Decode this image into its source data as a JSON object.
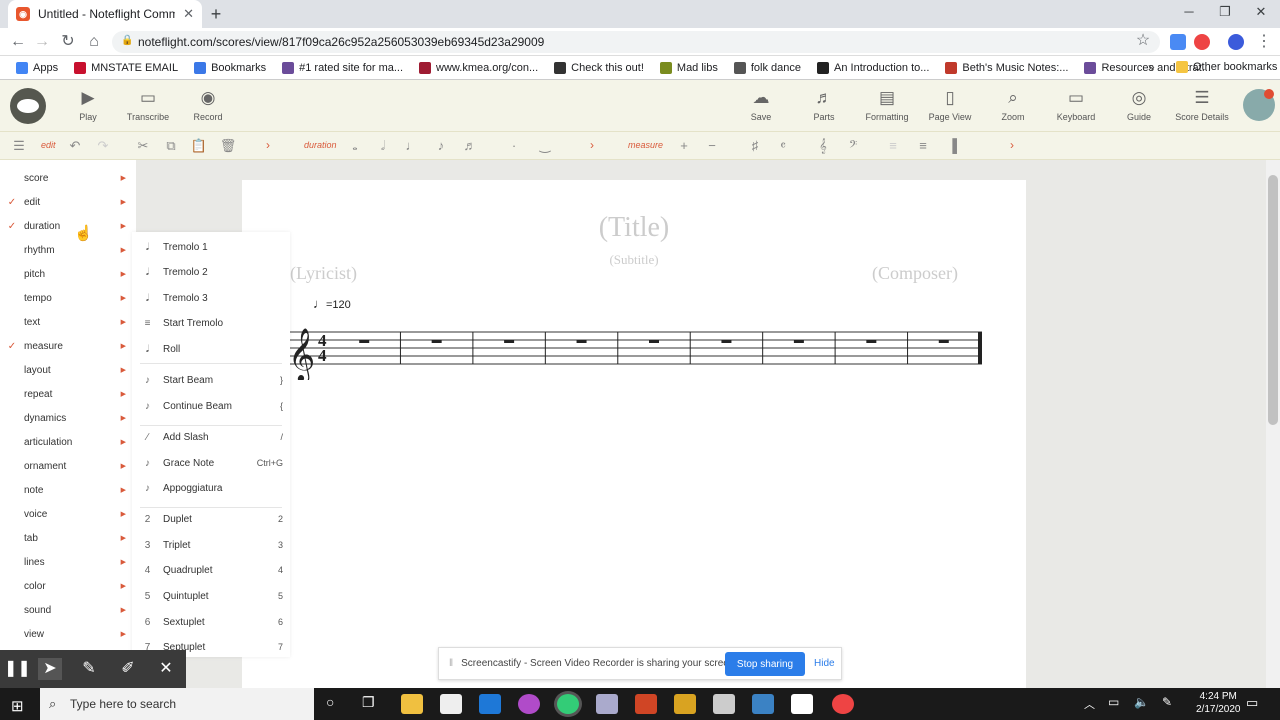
{
  "browser": {
    "tab_title": "Untitled - Noteflight Community",
    "url": "noteflight.com/scores/view/817f09ca26c952a256053039eb69345d23a29009",
    "bookmarks": [
      {
        "label": "Apps",
        "color": "#4285f4"
      },
      {
        "label": "MNSTATE EMAIL",
        "color": "#c8102e"
      },
      {
        "label": "Bookmarks",
        "color": "#3b78e7"
      },
      {
        "label": "#1 rated site for ma...",
        "color": "#6b4c9a"
      },
      {
        "label": "www.kmea.org/con...",
        "color": "#9e1b32"
      },
      {
        "label": "Check this out!",
        "color": "#333333"
      },
      {
        "label": "Mad libs",
        "color": "#7a8c1f"
      },
      {
        "label": "folk dance",
        "color": "#555555"
      },
      {
        "label": "An Introduction to...",
        "color": "#222222"
      },
      {
        "label": "Beth's Music Notes:...",
        "color": "#c0392b"
      },
      {
        "label": "Resources and Strat...",
        "color": "#6b4c9a"
      }
    ],
    "other_bookmarks": "Other bookmarks",
    "overflow": "»"
  },
  "toolbar": {
    "left": [
      {
        "label": "Play",
        "icon": "play-icon"
      },
      {
        "label": "Transcribe",
        "icon": "keyboard-icon"
      },
      {
        "label": "Record",
        "icon": "record-icon"
      }
    ],
    "right": [
      {
        "label": "Save",
        "icon": "cloud-icon"
      },
      {
        "label": "Parts",
        "icon": "guitar-icon"
      },
      {
        "label": "Formatting",
        "icon": "formatting-icon"
      },
      {
        "label": "Page View",
        "icon": "page-icon"
      },
      {
        "label": "Zoom",
        "icon": "zoom-icon"
      },
      {
        "label": "Keyboard",
        "icon": "keyboard-icon"
      },
      {
        "label": "Guide",
        "icon": "guide-icon"
      },
      {
        "label": "Score Details",
        "icon": "details-icon"
      }
    ]
  },
  "subtoolbar": {
    "edit": "edit",
    "duration": "duration",
    "measure": "measure"
  },
  "menu": {
    "items": [
      {
        "label": "score",
        "checked": false
      },
      {
        "label": "edit",
        "checked": true
      },
      {
        "label": "duration",
        "checked": true
      },
      {
        "label": "rhythm",
        "checked": false
      },
      {
        "label": "pitch",
        "checked": false
      },
      {
        "label": "tempo",
        "checked": false
      },
      {
        "label": "text",
        "checked": false
      },
      {
        "label": "measure",
        "checked": true
      },
      {
        "label": "layout",
        "checked": false
      },
      {
        "label": "repeat",
        "checked": false
      },
      {
        "label": "dynamics",
        "checked": false
      },
      {
        "label": "articulation",
        "checked": false
      },
      {
        "label": "ornament",
        "checked": false
      },
      {
        "label": "note",
        "checked": false
      },
      {
        "label": "voice",
        "checked": false
      },
      {
        "label": "tab",
        "checked": false
      },
      {
        "label": "lines",
        "checked": false
      },
      {
        "label": "color",
        "checked": false
      },
      {
        "label": "sound",
        "checked": false
      },
      {
        "label": "view",
        "checked": false
      }
    ],
    "check": "✓"
  },
  "submenu": {
    "items": [
      {
        "label": "Tremolo 1",
        "shortcut": "",
        "icon": "𝅘𝅥"
      },
      {
        "label": "Tremolo 2",
        "shortcut": "",
        "icon": "𝅘𝅥"
      },
      {
        "label": "Tremolo 3",
        "shortcut": "",
        "icon": "𝅘𝅥"
      },
      {
        "label": "Start Tremolo",
        "shortcut": "",
        "icon": "≡"
      },
      {
        "label": "Roll",
        "shortcut": "",
        "icon": "𝅘𝅥"
      },
      {
        "label": "Start Beam",
        "shortcut": "}",
        "icon": "♪"
      },
      {
        "label": "Continue Beam",
        "shortcut": "{",
        "icon": "♪"
      },
      {
        "label": "Add Slash",
        "shortcut": "/",
        "icon": "∕"
      },
      {
        "label": "Grace Note",
        "shortcut": "Ctrl+G",
        "icon": "♪"
      },
      {
        "label": "Appoggiatura",
        "shortcut": "",
        "icon": "♪"
      },
      {
        "label": "Duplet",
        "shortcut": "2",
        "icon": "2"
      },
      {
        "label": "Triplet",
        "shortcut": "3",
        "icon": "3"
      },
      {
        "label": "Quadruplet",
        "shortcut": "4",
        "icon": "4"
      },
      {
        "label": "Quintuplet",
        "shortcut": "5",
        "icon": "5"
      },
      {
        "label": "Sextuplet",
        "shortcut": "6",
        "icon": "6"
      },
      {
        "label": "Septuplet",
        "shortcut": "7",
        "icon": "7"
      }
    ]
  },
  "score": {
    "title": "(Title)",
    "subtitle": "(Subtitle)",
    "lyricist": "(Lyricist)",
    "composer": "(Composer)",
    "tempo": "=120",
    "time_top": "4",
    "time_bottom": "4",
    "measures": 9
  },
  "screencastify": {
    "message": "Screencastify - Screen Video Recorder is sharing your screen.",
    "stop": "Stop sharing",
    "hide": "Hide"
  },
  "taskbar": {
    "search_placeholder": "Type here to search",
    "time": "4:24 PM",
    "date": "2/17/2020"
  }
}
